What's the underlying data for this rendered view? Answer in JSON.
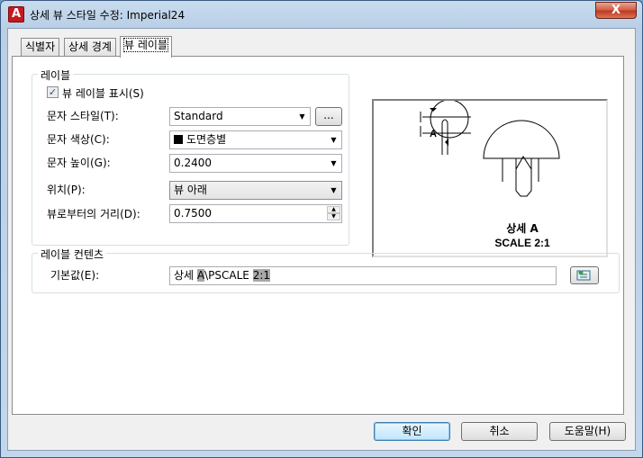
{
  "window": {
    "title": "상세 뷰 스타일 수정: Imperial24",
    "close_label": "X",
    "app_icon_letter": "A"
  },
  "tabs": [
    {
      "label": "식별자"
    },
    {
      "label": "상세 경계"
    },
    {
      "label": "뷰 레이블"
    }
  ],
  "label_group": {
    "title": "레이블",
    "show_view_label": "뷰 레이블 표시(S)",
    "show_view_label_checked": true,
    "text_style_label": "문자 스타일(T):",
    "text_style_value": "Standard",
    "browse_label": "...",
    "text_color_label": "문자 색상(C):",
    "text_color_value": "도면층별",
    "text_height_label": "문자 높이(G):",
    "text_height_value": "0.2400",
    "position_label": "위치(P):",
    "position_value": "뷰 아래",
    "distance_label": "뷰로부터의 거리(D):",
    "distance_value": "0.7500"
  },
  "preview": {
    "marker_letter": "A",
    "caption_line1": "상세 A",
    "caption_line2": "SCALE 2:1"
  },
  "contents_group": {
    "title": "레이블 컨텐츠",
    "default_label": "기본값(E):",
    "default_value_parts": [
      "상세 ",
      "A",
      "\\P",
      "SCALE ",
      "2:1"
    ]
  },
  "buttons": {
    "ok": "확인",
    "cancel": "취소",
    "help": "도움말(H)"
  },
  "colors": {
    "title_bar": "#c9dcef",
    "close_red": "#c0391f",
    "highlight": "#a8a8a8"
  }
}
